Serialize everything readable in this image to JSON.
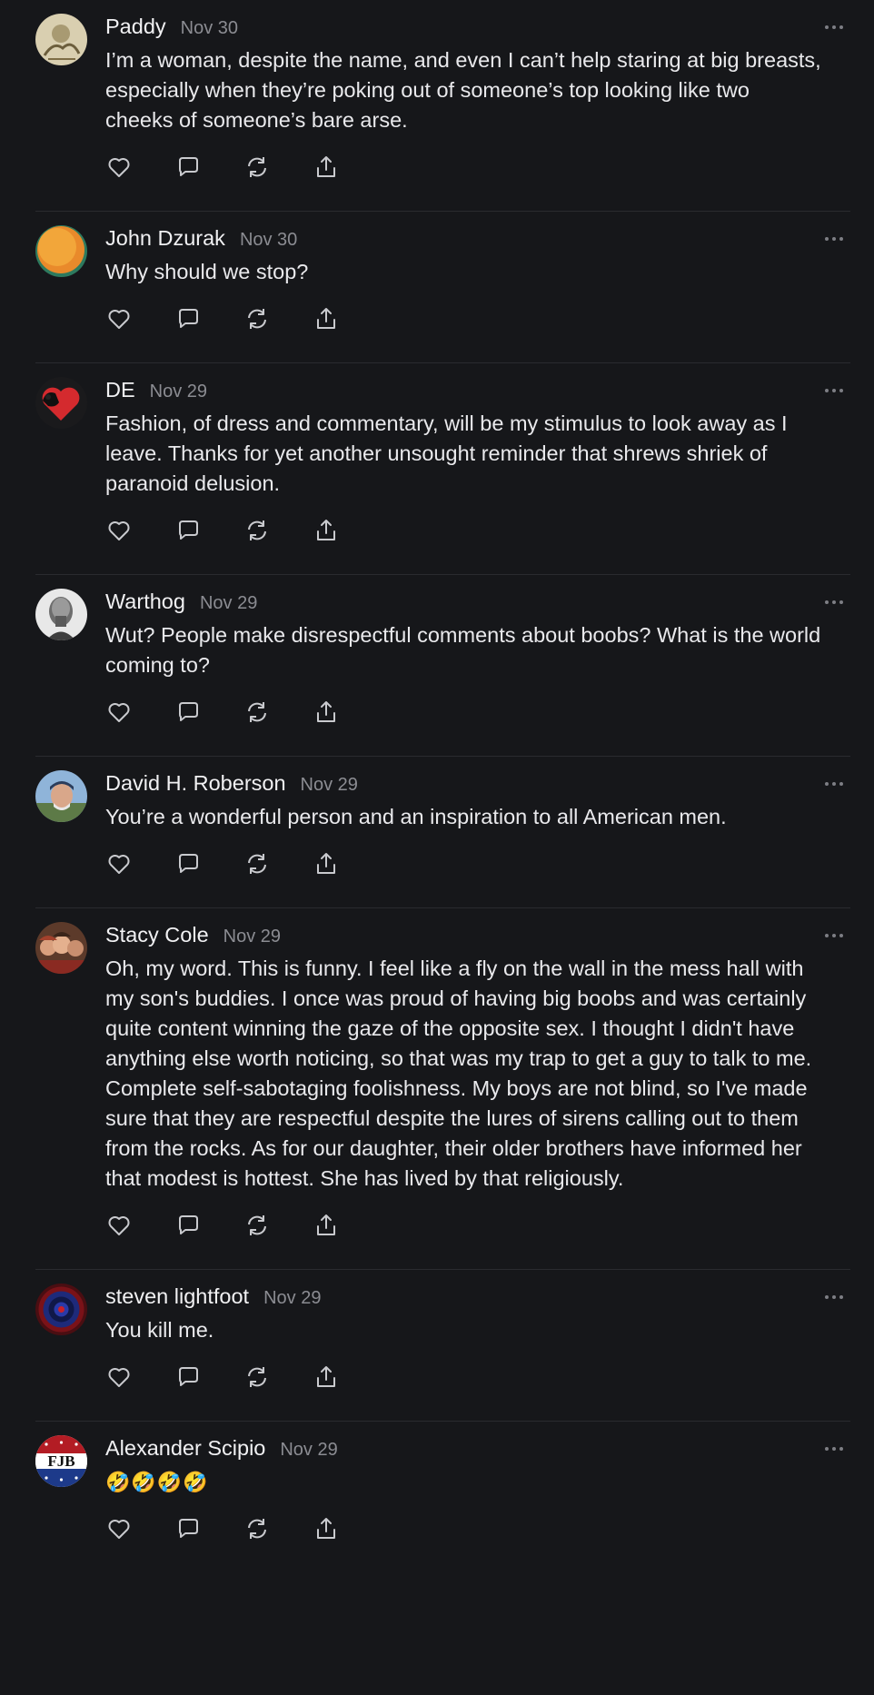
{
  "comments": [
    {
      "author": "Paddy",
      "date": "Nov 30",
      "text": "I’m a woman, despite the name, and even I can’t help staring at big breasts,\nespecially when they’re poking out of someone’s top looking like two\ncheeks of someone’s bare arse.",
      "avatar": "illustration-avatar"
    },
    {
      "author": "John Dzurak",
      "date": "Nov 30",
      "text": "Why should we stop?",
      "avatar": "orange-circle-avatar"
    },
    {
      "author": "DE",
      "date": "Nov 29",
      "text": "Fashion, of dress and commentary, will be my stimulus to look away as I\nleave. Thanks for yet another unsought reminder that shrews shriek of\nparanoid delusion.",
      "avatar": "dog-heart-avatar"
    },
    {
      "author": "Warthog",
      "date": "Nov 29",
      "text": "Wut? People make disrespectful comments about boobs? What is the world\ncoming to?",
      "avatar": "bw-portrait-avatar"
    },
    {
      "author": "David H. Roberson",
      "date": "Nov 29",
      "text": "You’re a wonderful person and an inspiration to all American men.",
      "avatar": "photo-portrait-avatar"
    },
    {
      "author": "Stacy Cole",
      "date": "Nov 29",
      "text": "Oh, my word. This is funny. I feel like a fly on the wall in the mess hall with\nmy son's buddies. I once was proud of having big boobs and was certainly\nquite content winning the gaze of the opposite sex. I thought I didn't have\nanything else worth noticing, so that was my trap to get a guy to talk to me.\nComplete self-sabotaging foolishness. My boys are not blind, so I've made\nsure that they are respectful despite the lures of sirens calling out to them\nfrom the rocks. As for our daughter, their older brothers have informed her\nthat modest is hottest. She has lived by that religiously.",
      "avatar": "group-photo-avatar"
    },
    {
      "author": "steven lightfoot",
      "date": "Nov 29",
      "text": "You kill me.",
      "avatar": "target-avatar"
    },
    {
      "author": "Alexander Scipio",
      "date": "Nov 29",
      "text": "🤣🤣🤣🤣",
      "avatar": "fjb-badge-avatar",
      "badge_text": "FJB"
    }
  ],
  "icons": {
    "like": "heart-icon",
    "reply": "speech-bubble-icon",
    "restack": "restack-icon",
    "share": "share-icon",
    "more": "more-dots-icon"
  },
  "colors": {
    "background": "#16171a",
    "text": "#e9e9ec",
    "muted": "#8b8c92",
    "divider": "#2a2b2f"
  }
}
